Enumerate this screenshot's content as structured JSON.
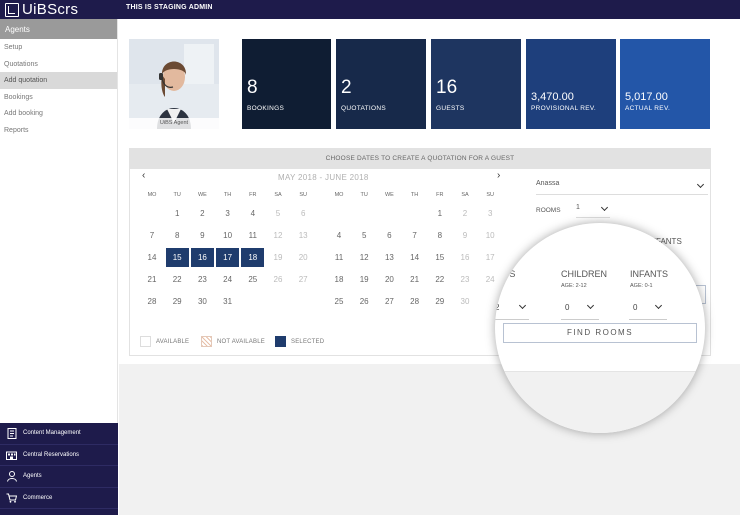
{
  "header": {
    "logo_text": "UiBScrs",
    "staging_text": "THIS IS STAGING ADMIN",
    "color": "#1e1b4b"
  },
  "sidebar": {
    "section_title": "Agents",
    "items": [
      {
        "label": "Setup"
      },
      {
        "label": "Quotations"
      },
      {
        "label": "Add quotation",
        "active": true
      },
      {
        "label": "Bookings"
      },
      {
        "label": "Add booking"
      },
      {
        "label": "Reports"
      }
    ],
    "bottom_nav": [
      {
        "label": "Content Management",
        "icon": "document-icon"
      },
      {
        "label": "Central Reservations",
        "icon": "building-icon"
      },
      {
        "label": "Agents",
        "icon": "person-icon"
      },
      {
        "label": "Commerce",
        "icon": "cart-icon"
      }
    ]
  },
  "agent": {
    "label": "UiBS Agent"
  },
  "stats": [
    {
      "value": "8",
      "label": "BOOKINGS",
      "color": "#0f1d33"
    },
    {
      "value": "2",
      "label": "QUOTATIONS",
      "color": "#17294a"
    },
    {
      "value": "16",
      "label": "GUESTS",
      "color": "#1e3560"
    },
    {
      "value": "3,470.00",
      "label": "PROVISIONAL REV.",
      "color": "#1e3f7c"
    },
    {
      "value": "5,017.00",
      "label": "ACTUAL REV.",
      "color": "#2356a8"
    }
  ],
  "quote": {
    "title": "CHOOSE DATES TO CREATE A QUOTATION FOR A GUEST",
    "calendar_title": "MAY 2018 - JUNE 2018",
    "prev": "‹",
    "next": "›",
    "weekdays": [
      "MO",
      "TU",
      "WE",
      "TH",
      "FR",
      "SA",
      "SU"
    ],
    "may": [
      [
        "",
        "1",
        "2",
        "3",
        "4",
        "5",
        "6"
      ],
      [
        "7",
        "8",
        "9",
        "10",
        "11",
        "12",
        "13"
      ],
      [
        "14",
        "15",
        "16",
        "17",
        "18",
        "19",
        "20"
      ],
      [
        "21",
        "22",
        "23",
        "24",
        "25",
        "26",
        "27"
      ],
      [
        "28",
        "29",
        "30",
        "31",
        "",
        "",
        ""
      ]
    ],
    "june": [
      [
        "",
        "",
        "",
        "",
        "1",
        "2",
        "3"
      ],
      [
        "4",
        "5",
        "6",
        "7",
        "8",
        "9",
        "10"
      ],
      [
        "11",
        "12",
        "13",
        "14",
        "15",
        "16",
        "17"
      ],
      [
        "18",
        "19",
        "20",
        "21",
        "22",
        "23",
        "24"
      ],
      [
        "25",
        "26",
        "27",
        "28",
        "29",
        "30",
        ""
      ]
    ],
    "selected_may": [
      "15",
      "16",
      "17",
      "18"
    ],
    "legend": {
      "available": "AVAILABLE",
      "not_available": "NOT AVAILABLE",
      "selected": "SELECTED"
    },
    "hotel_select": "Anassa",
    "rooms_label": "ROOMS",
    "rooms_value": "1",
    "infants_partial": "INFANTS"
  },
  "lens": {
    "adults_partial": "ULTS",
    "children": "CHILDREN",
    "children_age": "AGE: 2-12",
    "infants": "INFANTS",
    "infants_age": "AGE: 0-1",
    "adults_value": "2",
    "children_value": "0",
    "infants_value": "0",
    "find_rooms": "FIND ROOMS"
  }
}
